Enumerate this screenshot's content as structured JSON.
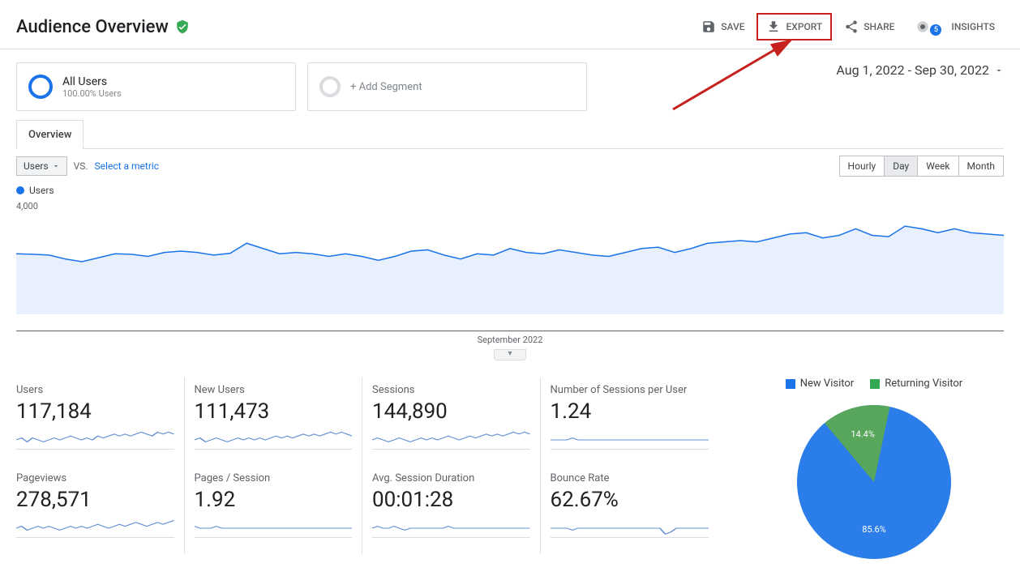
{
  "header": {
    "title": "Audience Overview",
    "actions": {
      "save": "SAVE",
      "export": "EXPORT",
      "share": "SHARE",
      "insights": "INSIGHTS",
      "insights_count": "5"
    }
  },
  "segments": {
    "all_users": {
      "name": "All Users",
      "sub": "100.00% Users"
    },
    "add": "+ Add Segment"
  },
  "date_range": "Aug 1, 2022 - Sep 30, 2022",
  "tab": "Overview",
  "controls": {
    "metric_dd": "Users",
    "vs": "VS.",
    "select_metric": "Select a metric",
    "granularity": [
      "Hourly",
      "Day",
      "Week",
      "Month"
    ],
    "active_gran": "Day"
  },
  "chart_data": {
    "type": "line",
    "series": [
      {
        "name": "Users",
        "color": "#1a73e8"
      }
    ],
    "ylim": [
      0,
      4000
    ],
    "yticks": [
      2000,
      4000
    ],
    "values": [
      2300,
      2280,
      2250,
      2100,
      2000,
      2150,
      2300,
      2280,
      2200,
      2350,
      2400,
      2350,
      2250,
      2320,
      2700,
      2500,
      2300,
      2350,
      2300,
      2200,
      2300,
      2200,
      2050,
      2200,
      2400,
      2450,
      2250,
      2100,
      2300,
      2250,
      2500,
      2350,
      2300,
      2450,
      2350,
      2250,
      2200,
      2350,
      2500,
      2550,
      2350,
      2500,
      2700,
      2750,
      2800,
      2750,
      2900,
      3050,
      3100,
      2900,
      3000,
      3250,
      3000,
      2950,
      3350,
      3250,
      3100,
      3250,
      3100,
      3050,
      3000
    ],
    "xlabel": "September 2022"
  },
  "metrics": [
    {
      "label": "Users",
      "value": "117,184",
      "spark": [
        5,
        6,
        4,
        6,
        5,
        4,
        5,
        6,
        5,
        6,
        7,
        6,
        5,
        6,
        5,
        7,
        6,
        7,
        8,
        7,
        8,
        7,
        8,
        9,
        8,
        7,
        9,
        8,
        9,
        8
      ]
    },
    {
      "label": "New Users",
      "value": "111,473",
      "spark": [
        5,
        6,
        4,
        5,
        6,
        5,
        4,
        5,
        6,
        5,
        6,
        5,
        6,
        5,
        6,
        7,
        6,
        7,
        6,
        7,
        8,
        7,
        8,
        7,
        8,
        9,
        8,
        9,
        8,
        7
      ]
    },
    {
      "label": "Sessions",
      "value": "144,890",
      "spark": [
        5,
        6,
        5,
        4,
        5,
        6,
        5,
        4,
        5,
        6,
        5,
        6,
        5,
        6,
        7,
        6,
        5,
        6,
        7,
        6,
        7,
        8,
        7,
        8,
        7,
        8,
        9,
        8,
        9,
        8
      ]
    },
    {
      "label": "Number of Sessions per User",
      "value": "1.24",
      "spark": [
        5,
        5,
        5,
        5,
        6,
        5,
        5,
        5,
        5,
        5,
        5,
        5,
        5,
        5,
        5,
        5,
        5,
        5,
        5,
        5,
        5,
        5,
        5,
        5,
        5,
        5,
        5,
        5,
        5,
        5
      ]
    },
    {
      "label": "Pageviews",
      "value": "278,571",
      "spark": [
        5,
        6,
        4,
        5,
        6,
        5,
        6,
        5,
        4,
        5,
        6,
        5,
        6,
        5,
        6,
        7,
        6,
        5,
        6,
        7,
        6,
        7,
        8,
        7,
        6,
        7,
        8,
        7,
        8,
        9
      ]
    },
    {
      "label": "Pages / Session",
      "value": "1.92",
      "spark": [
        6,
        5,
        5,
        5,
        6,
        5,
        5,
        5,
        5,
        5,
        5,
        5,
        5,
        5,
        5,
        5,
        5,
        5,
        5,
        5,
        5,
        5,
        5,
        5,
        5,
        5,
        5,
        5,
        5,
        5
      ]
    },
    {
      "label": "Avg. Session Duration",
      "value": "00:01:28",
      "spark": [
        5,
        6,
        5,
        5,
        6,
        5,
        4,
        5,
        5,
        5,
        5,
        5,
        5,
        5,
        6,
        5,
        5,
        5,
        5,
        5,
        5,
        5,
        5,
        5,
        5,
        5,
        5,
        5,
        5,
        5
      ]
    },
    {
      "label": "Bounce Rate",
      "value": "62.67%",
      "spark": [
        5,
        5,
        5,
        5,
        4,
        5,
        5,
        5,
        5,
        5,
        5,
        5,
        5,
        5,
        5,
        5,
        5,
        5,
        5,
        5,
        5,
        2,
        3,
        5,
        5,
        5,
        5,
        5,
        5,
        5
      ]
    }
  ],
  "pie": {
    "legend": [
      {
        "label": "New Visitor",
        "color": "#1a73e8"
      },
      {
        "label": "Returning Visitor",
        "color": "#34a853"
      }
    ],
    "slices": [
      {
        "label": "85.6%",
        "value": 85.6,
        "color": "#2b7de9"
      },
      {
        "label": "14.4%",
        "value": 14.4,
        "color": "#58a55c"
      }
    ]
  },
  "colors": {
    "brand": "#1a73e8",
    "highlight": "#c5221f"
  }
}
